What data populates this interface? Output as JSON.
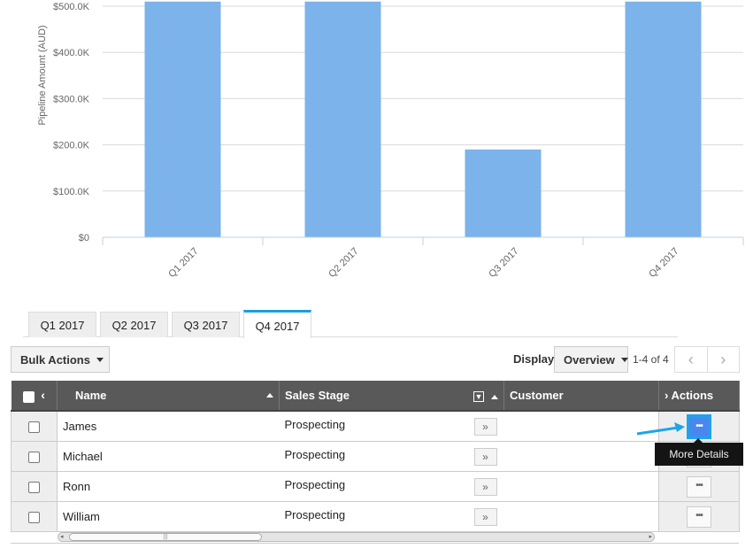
{
  "chart_data": {
    "type": "bar",
    "title": "",
    "xlabel": "",
    "ylabel": "Pipeline Amount (AUD)",
    "categories": [
      "Q1 2017",
      "Q2 2017",
      "Q3 2017",
      "Q4 2017"
    ],
    "values": [
      510000,
      510000,
      190000,
      510000
    ],
    "values_note": "Q1, Q2, Q4 extend beyond the visible top of the chart (> $500.0K)",
    "ylim": [
      0,
      510000
    ],
    "yticks": [
      0,
      100000,
      200000,
      300000,
      400000,
      500000
    ],
    "ytick_labels": [
      "$0",
      "$100.0K",
      "$200.0K",
      "$300.0K",
      "$400.0K",
      "$500.0K"
    ],
    "grid": true,
    "bar_color": "#7bb3ea"
  },
  "tabs": [
    {
      "label": "Q1 2017",
      "active": false
    },
    {
      "label": "Q2 2017",
      "active": false
    },
    {
      "label": "Q3 2017",
      "active": false
    },
    {
      "label": "Q4 2017",
      "active": true
    }
  ],
  "toolbar": {
    "bulk_actions": "Bulk Actions",
    "display_label": "Display",
    "display_value": "Overview",
    "page_count": "1-4 of 4",
    "prev": "‹",
    "next": "›"
  },
  "table": {
    "columns": {
      "name": "Name",
      "sales_stage": "Sales Stage",
      "customer": "Customer",
      "actions": "Actions"
    },
    "rows": [
      {
        "name": "James",
        "sales_stage": "Prospecting",
        "customer": ""
      },
      {
        "name": "Michael",
        "sales_stage": "Prospecting",
        "customer": ""
      },
      {
        "name": "Ronn",
        "sales_stage": "Prospecting",
        "customer": ""
      },
      {
        "name": "William",
        "sales_stage": "Prospecting",
        "customer": ""
      }
    ],
    "stage_btn": "»",
    "more_btn": "•••"
  },
  "tooltip": "More Details",
  "colors": {
    "accent": "#1a9fe0",
    "highlight": "#4a86f0",
    "header": "#595959"
  }
}
